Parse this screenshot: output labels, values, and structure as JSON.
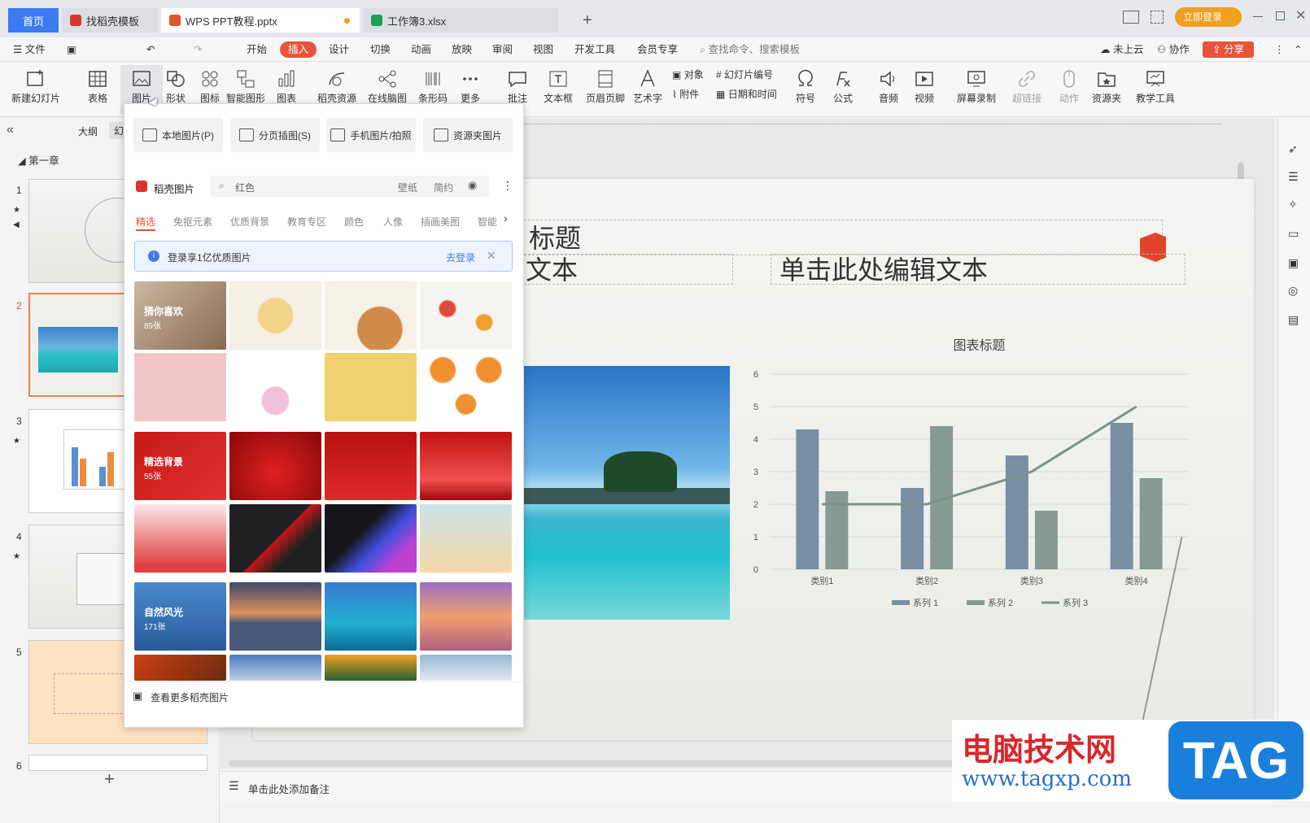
{
  "titlebar": {
    "home_tab": "首页",
    "tabs": [
      {
        "label": "找稻壳模板",
        "color": "#d9342b"
      },
      {
        "label": "WPS PPT教程.pptx",
        "color": "#e0552b"
      },
      {
        "label": "工作簿3.xlsx",
        "color": "#1e9e5b"
      }
    ],
    "login": "立即登录"
  },
  "menubar": {
    "file": "文件",
    "items": [
      "开始",
      "插入",
      "设计",
      "切换",
      "动画",
      "放映",
      "审阅",
      "视图",
      "开发工具",
      "会员专享"
    ],
    "active": "插入",
    "search_placeholder": "查找命令、搜索模板",
    "cloud": "未上云",
    "collab": "协作",
    "share": "分享"
  },
  "ribbon": {
    "items": [
      "新建幻灯片",
      "表格",
      "图片",
      "形状",
      "图标",
      "智能图形",
      "图表",
      "稻壳资源",
      "在线脑图",
      "条形码",
      "更多",
      "批注",
      "文本框",
      "页眉页脚",
      "艺术字",
      "符号",
      "公式",
      "音频",
      "视频",
      "屏幕录制",
      "超链接",
      "动作",
      "资源夹",
      "教学工具"
    ],
    "small": [
      "对象",
      "幻灯片编号",
      "附件",
      "日期和时间"
    ]
  },
  "leftpanel": {
    "tabs": [
      "大纲",
      "幻"
    ],
    "chapter": "第一章",
    "slides": [
      "1",
      "2",
      "3",
      "4",
      "5",
      "6"
    ],
    "add": "+"
  },
  "popup": {
    "buttons": [
      "本地图片(P)",
      "分页插图(S)",
      "手机图片/拍照",
      "资源夹图片"
    ],
    "brand": "稻壳图片",
    "search_value": "红色",
    "search_tags": [
      "壁纸",
      "简约"
    ],
    "tabs": [
      "精选",
      "免抠元素",
      "优质背景",
      "教育专区",
      "颜色",
      "人像",
      "插画美图",
      "智能"
    ],
    "active_tab": "精选",
    "banner": "登录享1亿优质图片",
    "banner_link": "去登录",
    "groups": [
      {
        "label": "猜你喜欢",
        "count": "89张"
      },
      {
        "label": "精选背景",
        "count": "55张"
      },
      {
        "label": "自然风光",
        "count": "171张"
      }
    ],
    "footer": "查看更多稻壳图片"
  },
  "slide": {
    "title": "标题",
    "text_left": "文本",
    "text_right": "单击此处编辑文本"
  },
  "chart_data": {
    "type": "bar",
    "title": "图表标题",
    "categories": [
      "类别1",
      "类别2",
      "类别3",
      "类别4"
    ],
    "ylim": [
      0,
      6
    ],
    "yticks": [
      "0",
      "1",
      "2",
      "3",
      "4",
      "5",
      "6"
    ],
    "series": [
      {
        "name": "系列 1",
        "type": "bar",
        "values": [
          4.3,
          2.5,
          3.5,
          4.5
        ],
        "color": "#7a8ea3"
      },
      {
        "name": "系列 2",
        "type": "bar",
        "values": [
          2.4,
          4.4,
          1.8,
          2.8
        ],
        "color": "#879a94"
      },
      {
        "name": "系列 3",
        "type": "line",
        "values": [
          2,
          2,
          3,
          5
        ],
        "color": "#7a9588"
      }
    ],
    "legend": "bottom"
  },
  "statusbar": {
    "notes": "单击此处添加备注"
  },
  "watermark": {
    "text": "电脑技术网",
    "url": "www.tagxp.com",
    "tag": "TAG"
  }
}
